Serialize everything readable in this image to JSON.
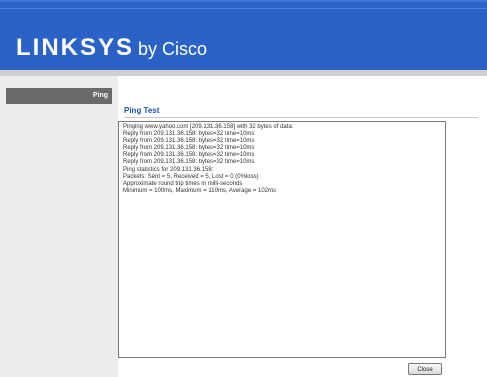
{
  "header": {
    "brand": "LINKSYS",
    "by": "by Cisco"
  },
  "sidebar": {
    "items": [
      {
        "label": "Ping"
      }
    ]
  },
  "main": {
    "title": "Ping Test",
    "output_lines": [
      "Pinging www.yahoo.com [209.131.36.158] with 32 bytes of data:",
      "Reply from 209.131.36.158: bytes=32 time=10ms",
      "Reply from 209.131.36.158: bytes=32 time=10ms",
      "Reply from 209.131.36.158: bytes=32 time=10ms",
      "Reply from 209.131.36.158: bytes=32 time=10ms",
      "Reply from 209.131.36.158: bytes=32 time=10ms",
      "Ping statistics for 209.131.36.158:",
      "Packets: Sent = 5, Received = 5, Lost = 0 (0%loss)",
      "Approximate round trip times in milli-seconds",
      "Minimum = 100ms, Maximum = 110ms, Average = 102ms"
    ],
    "close_label": "Close"
  }
}
